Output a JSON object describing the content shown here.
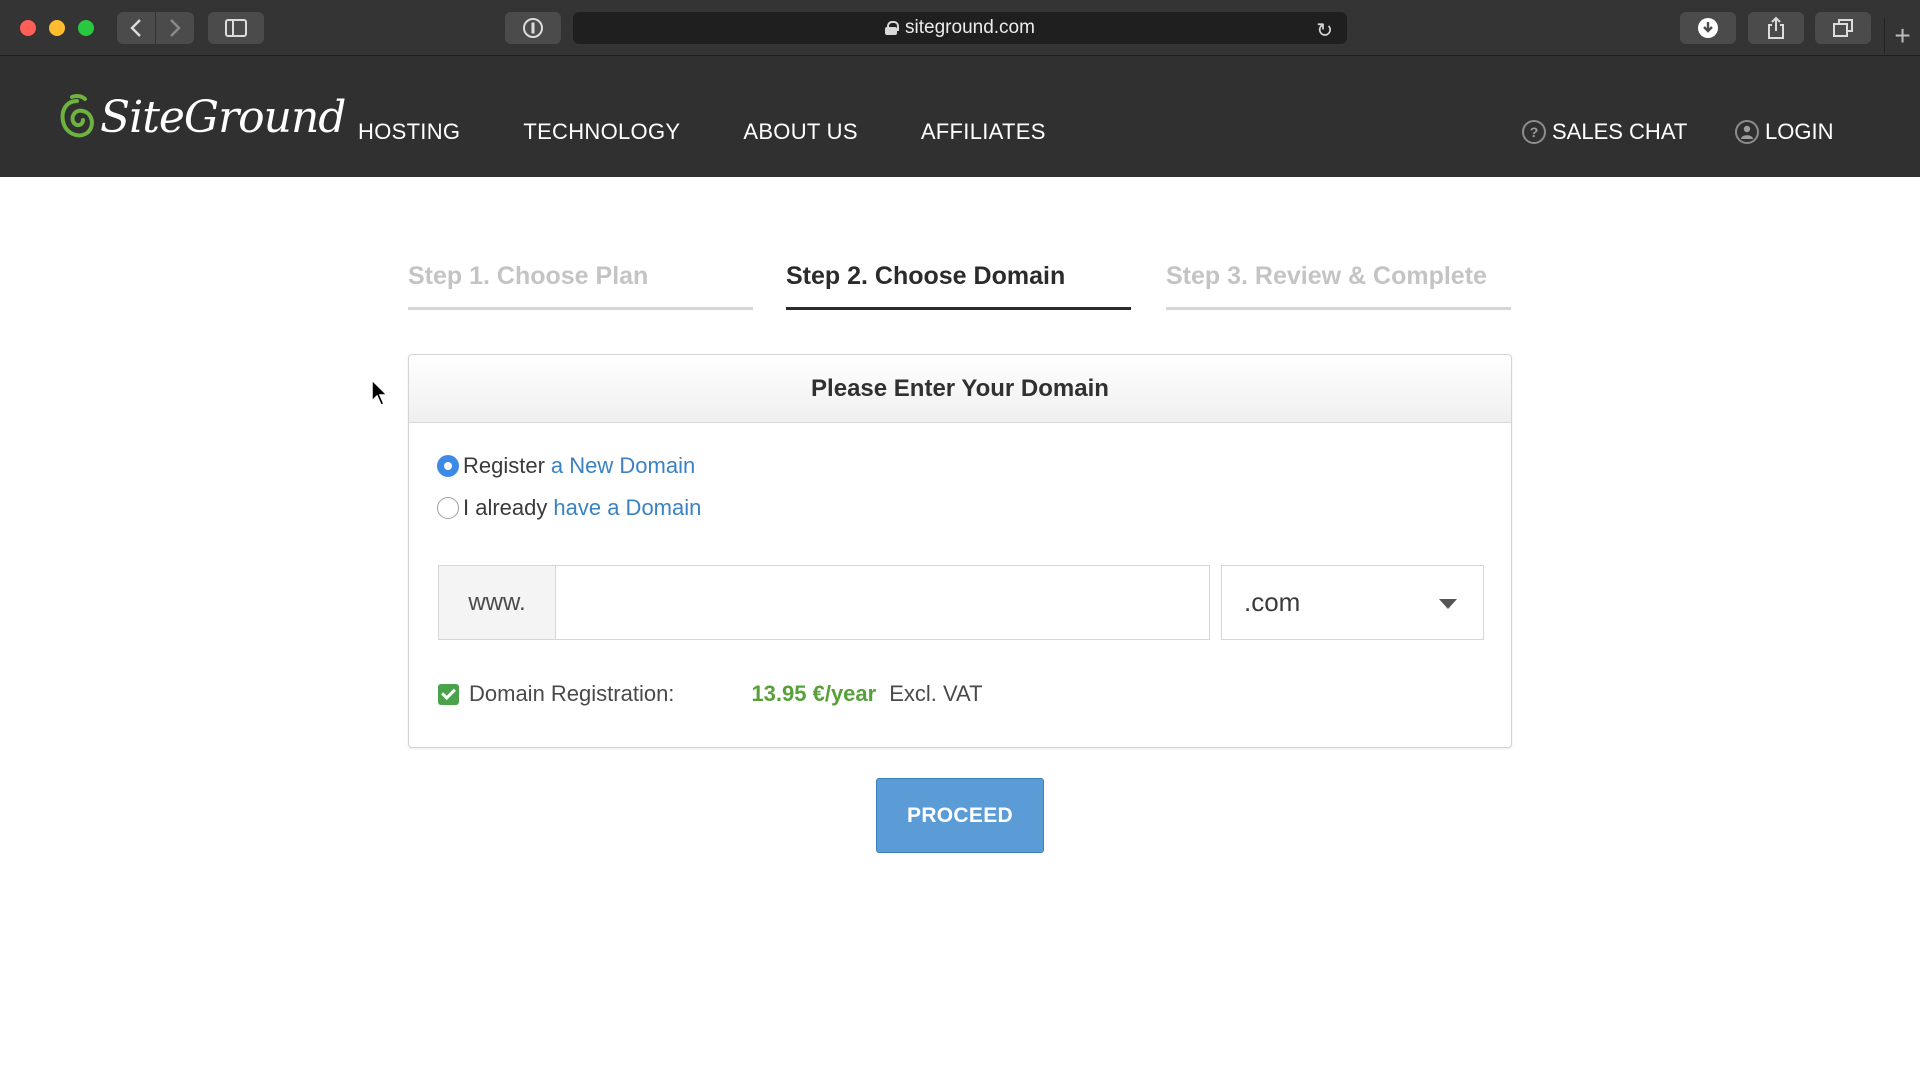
{
  "browser": {
    "url": "siteground.com"
  },
  "header": {
    "logo_text": "SiteGround",
    "nav": [
      "HOSTING",
      "TECHNOLOGY",
      "ABOUT US",
      "AFFILIATES"
    ],
    "sales_chat": "SALES CHAT",
    "login": "LOGIN"
  },
  "steps": {
    "step1": "Step 1. Choose Plan",
    "step2": "Step 2. Choose Domain",
    "step3": "Step 3. Review & Complete"
  },
  "card": {
    "title": "Please Enter Your Domain",
    "option1_prefix": "Register",
    "option1_link": "a New Domain",
    "option2_prefix": "I already",
    "option2_link": "have a Domain",
    "www_prefix": "www.",
    "domain_value": "",
    "tld_selected": ".com",
    "reg_label": "Domain Registration:",
    "reg_price": "13.95 €/year",
    "reg_vat": "Excl. VAT"
  },
  "proceed_label": "PROCEED",
  "colors": {
    "header_bg": "#303030",
    "link": "#3a82c4",
    "price": "#58a13a",
    "button": "#5b9cd6"
  }
}
